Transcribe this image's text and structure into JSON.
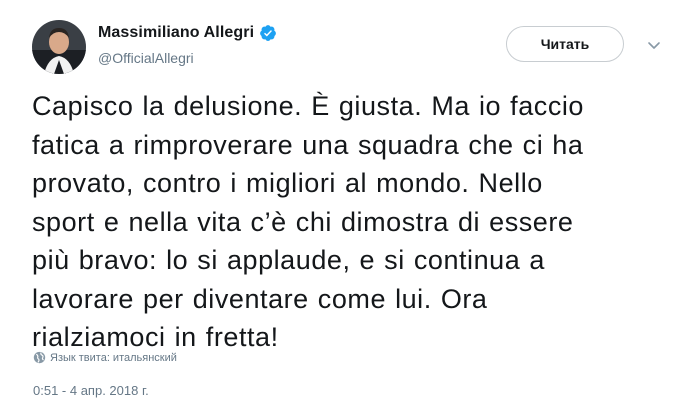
{
  "author": {
    "display_name": "Massimiliano Allegri",
    "handle": "@OfficialAllegri",
    "verified": true,
    "verified_icon": "verified-badge-icon",
    "verified_color": "#1da1f2"
  },
  "actions": {
    "follow_label": "Читать",
    "menu_icon": "chevron-down-icon"
  },
  "tweet": {
    "lines": [
      "Capisco la delusione. È giusta. Ma io faccio",
      "fatica a rimproverare una squadra che ci ha",
      "provato, contro i migliori al mondo. Nello",
      "sport e nella vita c’è chi dimostra di essere",
      "più bravo: lo si applaude, e si continua a",
      "lavorare per diventare come lui. Ora",
      "rialziamoci in fretta!"
    ],
    "language_label": "Язык твита: итальянский",
    "language_icon": "globe-icon",
    "timestamp": "0:51 - 4 апр. 2018 г."
  },
  "colors": {
    "text": "#14171a",
    "secondary": "#657786",
    "accent": "#1da1f2"
  }
}
